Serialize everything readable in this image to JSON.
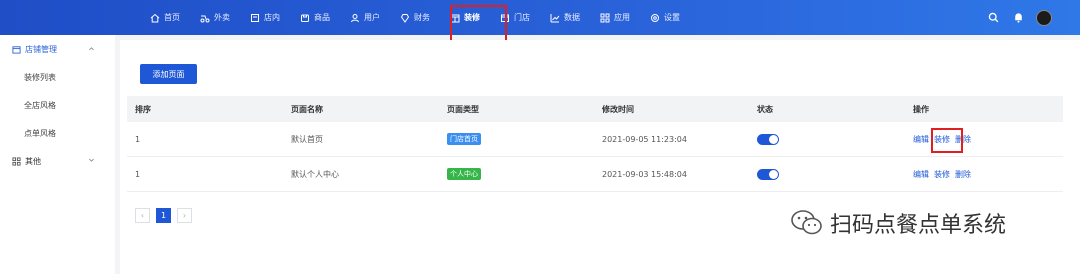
{
  "nav": {
    "items": [
      {
        "label": "首页",
        "icon": "home-icon"
      },
      {
        "label": "外卖",
        "icon": "delivery-icon"
      },
      {
        "label": "店内",
        "icon": "store-inside-icon"
      },
      {
        "label": "商品",
        "icon": "goods-icon"
      },
      {
        "label": "用户",
        "icon": "user-icon"
      },
      {
        "label": "财务",
        "icon": "finance-icon"
      },
      {
        "label": "装修",
        "icon": "decorate-icon"
      },
      {
        "label": "门店",
        "icon": "shop-icon"
      },
      {
        "label": "数据",
        "icon": "chart-icon"
      },
      {
        "label": "应用",
        "icon": "apps-icon"
      },
      {
        "label": "设置",
        "icon": "settings-icon"
      }
    ],
    "active": "装修"
  },
  "sidebar": {
    "group1": {
      "label": "店铺管理"
    },
    "items": [
      {
        "label": "装修列表"
      },
      {
        "label": "全店风格"
      },
      {
        "label": "点单风格"
      }
    ],
    "group2": {
      "label": "其他"
    }
  },
  "main": {
    "add_button": "添加页面",
    "table": {
      "headers": [
        "排序",
        "页面名称",
        "页面类型",
        "修改时间",
        "状态",
        "操作"
      ],
      "rows": [
        {
          "sort": "1",
          "name": "默认首页",
          "type": "门店首页",
          "type_color": "#3b8ff0",
          "time": "2021-09-05 11:23:04",
          "ops": [
            "编辑",
            "装修",
            "删除"
          ]
        },
        {
          "sort": "1",
          "name": "默认个人中心",
          "type": "个人中心",
          "type_color": "#35b54a",
          "time": "2021-09-03 15:48:04",
          "ops": [
            "编辑",
            "装修",
            "删除"
          ]
        }
      ]
    },
    "pager": {
      "current": "1",
      "prev": "‹",
      "next": "›"
    }
  },
  "watermark": "扫码点餐点单系统",
  "colors": {
    "primary": "#1f58d6",
    "highlight": "#e02020"
  }
}
